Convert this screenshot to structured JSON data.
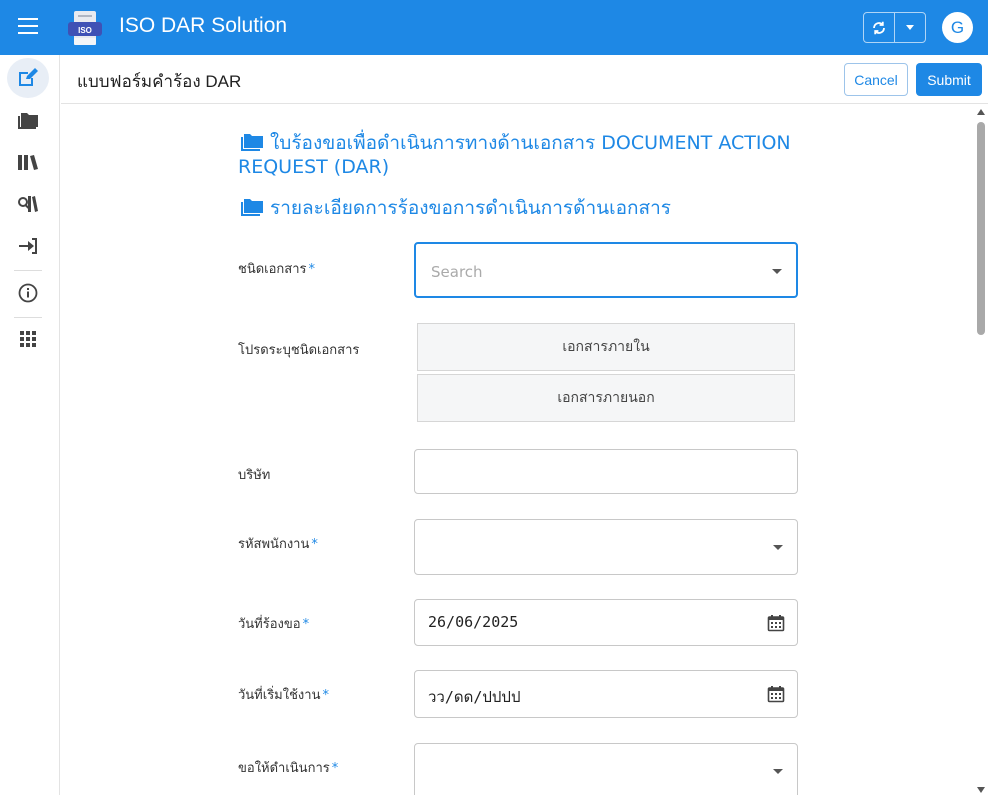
{
  "app": {
    "title": "ISO DAR Solution",
    "logo_text": "ISO",
    "avatar_initial": "G",
    "brand_color": "#1e88e5"
  },
  "header": {
    "page_title": "แบบฟอร์มคำร้อง DAR",
    "cancel_label": "Cancel",
    "submit_label": "Submit"
  },
  "sidebar": {
    "items": [
      {
        "icon": "edit-icon",
        "active": true
      },
      {
        "icon": "folder-icon"
      },
      {
        "icon": "library-icon"
      },
      {
        "icon": "search-library-icon"
      },
      {
        "icon": "sign-in-icon"
      },
      {
        "icon": "info-icon"
      },
      {
        "icon": "apps-grid-icon"
      }
    ]
  },
  "form": {
    "section1_title": "ใบร้องขอเพื่อดำเนินการทางด้านเอกสาร DOCUMENT ACTION REQUEST (DAR)",
    "section2_title": "รายละเอียดการร้องขอการดำเนินการด้านเอกสาร",
    "doc_type": {
      "label": "ชนิดเอกสาร",
      "placeholder": "Search"
    },
    "doc_kind": {
      "label": "โปรดระบุชนิดเอกสาร",
      "options": [
        "เอกสารภายใน",
        "เอกสารภายนอก"
      ]
    },
    "company": {
      "label": "บริษัท",
      "value": ""
    },
    "employee_id": {
      "label": "รหัสพนักงาน",
      "value": ""
    },
    "request_date": {
      "label": "วันที่ร้องขอ",
      "value": "26/06/2025"
    },
    "start_date": {
      "label": "วันที่เริ่มใช้งาน",
      "value": "วว/ดด/ปปปป"
    },
    "action": {
      "label": "ขอให้ดำเนินการ",
      "value": ""
    }
  }
}
